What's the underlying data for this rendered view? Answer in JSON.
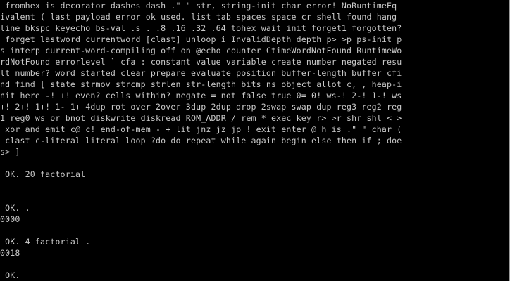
{
  "terminal": {
    "lines": [
      " fromhex is decorator dashes dash .\" \" str, string-init char error! NoRuntimeEq",
      "ivalent ( last payload error ok used. list tab spaces space cr shell found hang",
      "line bkspc keyecho bs-val .s . .8 .16 .32 .64 tohex wait init forget1 forgotten?",
      " forget lastword currentword [clast] unloop i InvalidDepth depth p> >p ps-init p",
      "s interp current-word-compiling off on @echo counter CtimeWordNotFound RuntimeWo",
      "rdNotFound errorlevel ` cfa : constant value variable create number negated resu",
      "lt number? word started clear prepare evaluate position buffer-length buffer cfi",
      "nd find [ state strmov strcmp strlen str-length bits ns object allot c, , heap-i",
      "nit here -! +! even? cells within? negate = not false true 0= 0! ws-! 2-! 1-! ws",
      "+! 2+! 1+! 1- 1+ 4dup rot over 2over 3dup 2dup drop 2swap swap dup reg3 reg2 reg",
      "1 reg0 ws or bnot diskwrite diskread ROM_ADDR / rem * exec key r> >r shr shl < >",
      " xor and emit c@ c! end-of-mem - + lit jnz jz jp ! exit enter @ h is .\" \" char (",
      " clast c-literal literal loop ?do do repeat while again begin else then if ; doe",
      "s> ]",
      "",
      " OK. 20 factorial",
      "",
      "",
      " OK. .",
      "0000",
      "",
      " OK. 4 factorial .",
      "0018",
      "",
      " OK."
    ]
  }
}
